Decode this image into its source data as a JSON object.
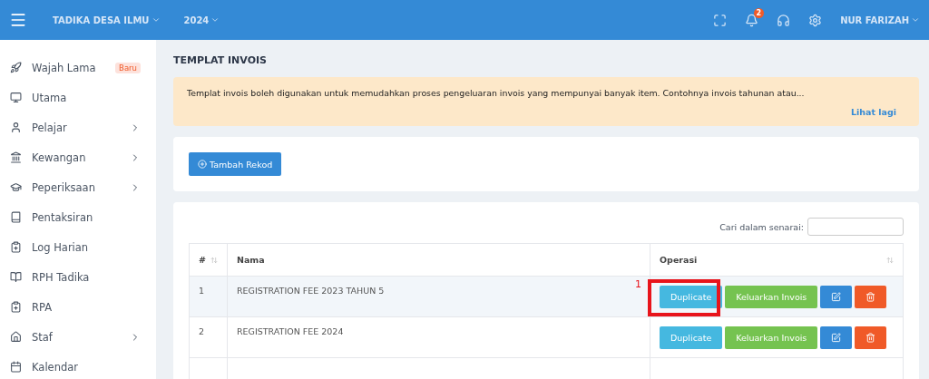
{
  "topbar": {
    "school": "TADIKA DESA ILMU",
    "year": "2024",
    "notification_count": "2",
    "user": "NUR FARIZAH"
  },
  "sidebar": {
    "items": [
      {
        "label": "Wajah Lama",
        "badge": "Baru",
        "expandable": false
      },
      {
        "label": "Utama",
        "expandable": false
      },
      {
        "label": "Pelajar",
        "expandable": true
      },
      {
        "label": "Kewangan",
        "expandable": true
      },
      {
        "label": "Peperiksaan",
        "expandable": true
      },
      {
        "label": "Pentaksiran",
        "expandable": false
      },
      {
        "label": "Log Harian",
        "expandable": false
      },
      {
        "label": "RPH Tadika",
        "expandable": false
      },
      {
        "label": "RPA",
        "expandable": false
      },
      {
        "label": "Staf",
        "expandable": true
      },
      {
        "label": "Kalendar",
        "expandable": false
      }
    ]
  },
  "page_title": "TEMPLAT INVOIS",
  "notice": {
    "text": "Templat invois boleh digunakan untuk memudahkan proses pengeluaran invois yang mempunyai banyak item. Contohnya invois tahunan atau...",
    "link": "Lihat lagi"
  },
  "add_button": "Tambah Rekod",
  "table": {
    "search_label": "Cari dalam senarai:",
    "columns": [
      "#",
      "Nama",
      "Operasi"
    ],
    "rows": [
      {
        "no": "1",
        "name": "REGISTRATION FEE 2023 TAHUN 5",
        "highlighted": true,
        "actions": [
          "Duplicate",
          "Keluarkan Invois"
        ]
      },
      {
        "no": "2",
        "name": "REGISTRATION FEE 2024",
        "highlighted": false,
        "actions": [
          "Duplicate",
          "Keluarkan Invois"
        ]
      }
    ]
  },
  "annotation": {
    "label": "1"
  }
}
